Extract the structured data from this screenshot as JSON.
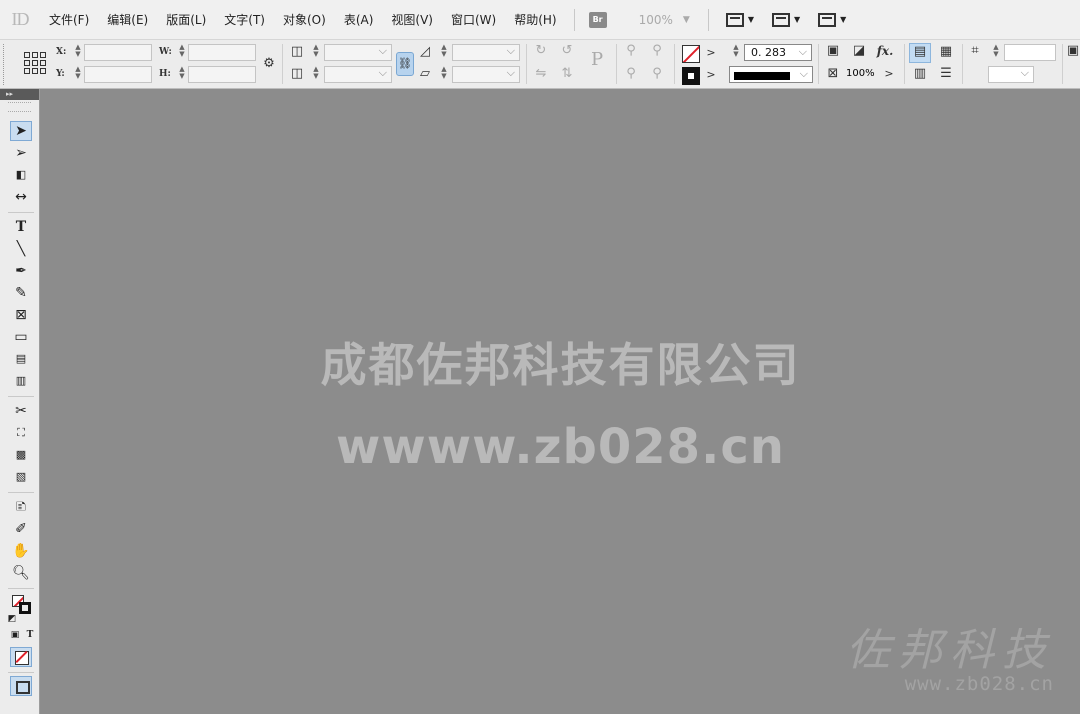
{
  "app": {
    "logo": "ID"
  },
  "menu": {
    "items": [
      "文件(F)",
      "编辑(E)",
      "版面(L)",
      "文字(T)",
      "对象(O)",
      "表(A)",
      "视图(V)",
      "窗口(W)",
      "帮助(H)"
    ],
    "bridge_button": "Br",
    "zoom": "100%"
  },
  "control": {
    "x_label": "X:",
    "y_label": "Y:",
    "w_label": "W:",
    "h_label": "H:",
    "stroke_weight": "0. 283",
    "opacity": "100%",
    "proxy_letter": "P"
  },
  "watermark": {
    "company": "成都佐邦科技有限公司",
    "url": "wwww.zb028.cn",
    "brand": "佐邦科技",
    "brand_url": "www.zb028.cn"
  },
  "colors": {
    "pasteboard": "#8c8c8c",
    "none_swatch": "#e0202a",
    "selected_tool": "#c9ddf0"
  },
  "icons": {
    "tools": [
      "selection-icon",
      "direct-selection-icon",
      "page-icon",
      "gap-icon",
      "type-icon",
      "line-icon",
      "pen-icon",
      "pencil-icon",
      "rectangle-frame-icon",
      "rectangle-icon",
      "horizontal-grid-icon",
      "vertical-grid-icon",
      "scissors-icon",
      "free-transform-icon",
      "gradient-swatch-icon",
      "gradient-feather-icon",
      "note-icon",
      "eyedropper-icon",
      "hand-icon",
      "zoom-icon"
    ]
  }
}
